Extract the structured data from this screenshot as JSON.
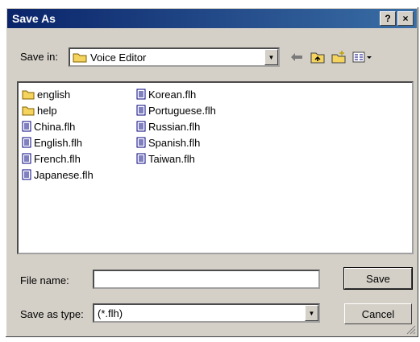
{
  "window": {
    "title": "Save As",
    "help_label": "?",
    "close_label": "×"
  },
  "save_in": {
    "label": "Save in:",
    "value": "Voice Editor"
  },
  "files": {
    "col1": [
      {
        "name": "english",
        "type": "folder"
      },
      {
        "name": "help",
        "type": "folder"
      },
      {
        "name": "China.flh",
        "type": "file"
      },
      {
        "name": "English.flh",
        "type": "file"
      },
      {
        "name": "French.flh",
        "type": "file"
      },
      {
        "name": "Japanese.flh",
        "type": "file"
      }
    ],
    "col2": [
      {
        "name": "Korean.flh",
        "type": "file"
      },
      {
        "name": "Portuguese.flh",
        "type": "file"
      },
      {
        "name": "Russian.flh",
        "type": "file"
      },
      {
        "name": "Spanish.flh",
        "type": "file"
      },
      {
        "name": "Taiwan.flh",
        "type": "file"
      }
    ]
  },
  "file_name": {
    "label": "File name:",
    "value": ""
  },
  "save_as_type": {
    "label": "Save as type:",
    "value": "(*.flh)"
  },
  "buttons": {
    "save": "Save",
    "cancel": "Cancel"
  },
  "colors": {
    "title_start": "#0a246a",
    "title_end": "#3a6ea5",
    "face": "#d4d0c8",
    "folder": "#f4d35e"
  }
}
